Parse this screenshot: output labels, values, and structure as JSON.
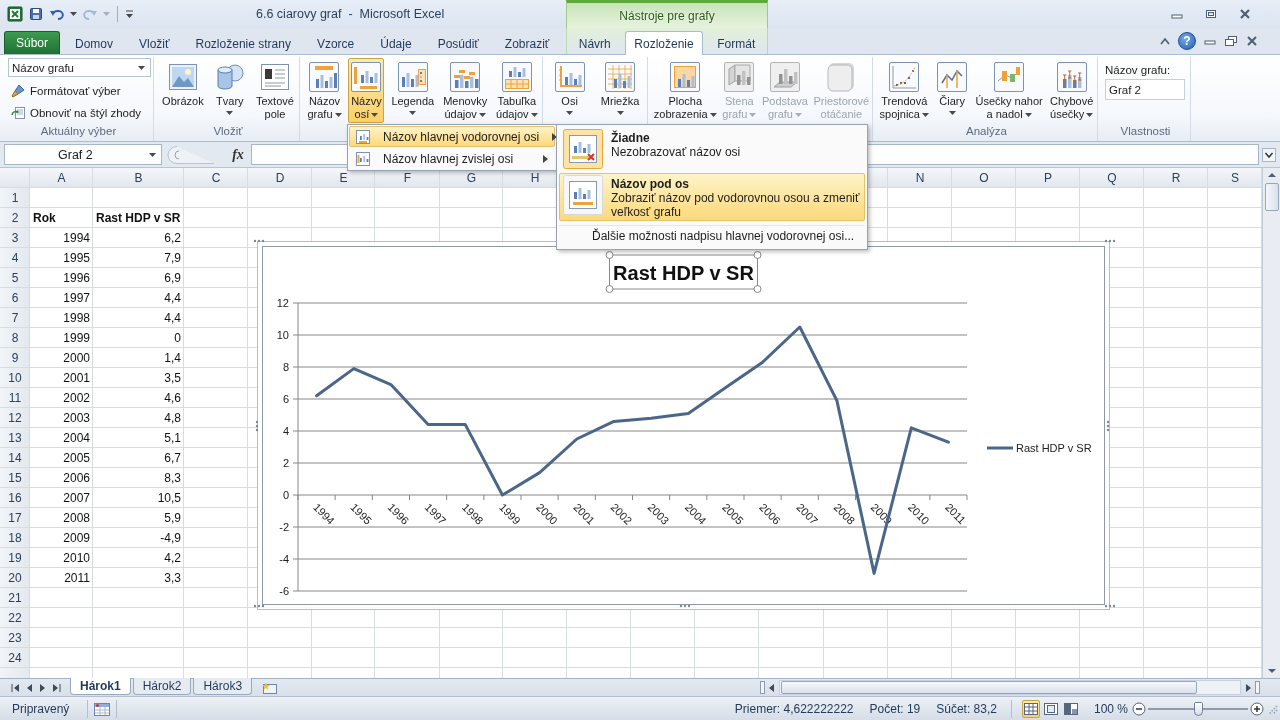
{
  "title_bar": {
    "quick_access": [
      {
        "disabled": false
      },
      {
        "disabled": false
      },
      {
        "disabled": true
      }
    ],
    "title": "6.6 ciarovy graf  -  Microsoft Excel",
    "contextual_group": "Nástroje pre grafy"
  },
  "tabs": [
    {
      "label": "Súbor",
      "kind": "file",
      "selected": false
    },
    {
      "label": "Domov",
      "kind": "normal",
      "selected": false
    },
    {
      "label": "Vložiť",
      "kind": "normal",
      "selected": false
    },
    {
      "label": "Rozloženie strany",
      "kind": "normal",
      "selected": false
    },
    {
      "label": "Vzorce",
      "kind": "normal",
      "selected": false
    },
    {
      "label": "Údaje",
      "kind": "normal",
      "selected": false
    },
    {
      "label": "Posúdiť",
      "kind": "normal",
      "selected": false
    },
    {
      "label": "Zobraziť",
      "kind": "normal",
      "selected": false
    },
    {
      "label": "Návrh",
      "kind": "contextual",
      "selected": false
    },
    {
      "label": "Rozloženie",
      "kind": "contextual",
      "selected": true
    },
    {
      "label": "Formát",
      "kind": "contextual",
      "selected": false
    }
  ],
  "help_button": "?",
  "ribbon": {
    "groups": [
      {
        "kind": "selection",
        "label": "Aktuálny výber",
        "dropdown": "Názov grafu",
        "buttons": [
          {
            "label": "Formátovať výber"
          },
          {
            "label": "Obnoviť na štýl zhody"
          }
        ]
      },
      {
        "kind": "large",
        "label": "Vložiť",
        "buttons": [
          {
            "lines": [
              "Obrázok"
            ],
            "menu": false,
            "pressed": false,
            "disabled": false
          },
          {
            "lines": [
              "Tvary"
            ],
            "menu": true,
            "pressed": false,
            "disabled": false
          },
          {
            "lines": [
              "Textové",
              "pole"
            ],
            "menu": false,
            "pressed": false,
            "disabled": false
          }
        ]
      },
      {
        "kind": "large",
        "buttons": [
          {
            "lines": [
              "Názov",
              "grafu"
            ],
            "menu": true,
            "pressed": false,
            "disabled": false
          },
          {
            "lines": [
              "Názvy",
              "osí"
            ],
            "menu": true,
            "pressed": true,
            "disabled": false
          },
          {
            "lines": [
              "Legenda"
            ],
            "menu": true,
            "pressed": false,
            "disabled": false
          },
          {
            "lines": [
              "Menovky",
              "údajov"
            ],
            "menu": true,
            "pressed": false,
            "disabled": false
          },
          {
            "lines": [
              "Tabuľka",
              "údajov"
            ],
            "menu": true,
            "pressed": false,
            "disabled": false
          }
        ]
      },
      {
        "kind": "large",
        "buttons": [
          {
            "lines": [
              "Osi"
            ],
            "menu": true,
            "pressed": false,
            "disabled": false
          },
          {
            "lines": [
              "Mriežka"
            ],
            "menu": true,
            "pressed": false,
            "disabled": false
          }
        ]
      },
      {
        "kind": "large",
        "buttons": [
          {
            "lines": [
              "Plocha",
              "zobrazenia"
            ],
            "menu": true,
            "pressed": false,
            "disabled": false
          },
          {
            "lines": [
              "Stena",
              "grafu"
            ],
            "menu": true,
            "pressed": false,
            "disabled": true
          },
          {
            "lines": [
              "Podstava",
              "grafu"
            ],
            "menu": true,
            "pressed": false,
            "disabled": true
          },
          {
            "lines": [
              "Priestorové",
              "otáčanie"
            ],
            "menu": false,
            "pressed": false,
            "disabled": true
          }
        ]
      },
      {
        "kind": "large",
        "label": "Analýza",
        "buttons": [
          {
            "lines": [
              "Trendová",
              "spojnica"
            ],
            "menu": true,
            "pressed": false,
            "disabled": false
          },
          {
            "lines": [
              "Čiary"
            ],
            "menu": true,
            "pressed": false,
            "disabled": false
          },
          {
            "lines": [
              "Úsečky nahor",
              "a nadol"
            ],
            "menu": true,
            "pressed": false,
            "disabled": false
          },
          {
            "lines": [
              "Chybové",
              "úsečky"
            ],
            "menu": true,
            "pressed": false,
            "disabled": false
          }
        ]
      },
      {
        "kind": "properties",
        "label": "Vlastnosti",
        "field_label": "Názov grafu:",
        "value": "Graf 2"
      }
    ]
  },
  "axis_titles_menu": {
    "items": [
      {
        "label": "Názov hlavnej vodorovnej osi",
        "highlighted": true
      },
      {
        "label": "Názov hlavnej zvislej osi",
        "highlighted": false
      }
    ]
  },
  "axis_title_submenu": {
    "items": [
      {
        "kind": "option",
        "title": "Žiadne",
        "description": "Nezobrazovať názov osi",
        "checked": true,
        "highlighted": false
      },
      {
        "kind": "option",
        "title": "Názov pod os",
        "description": "Zobraziť názov pod vodorovnou osou a zmeniť veľkosť grafu",
        "checked": false,
        "highlighted": true
      },
      {
        "kind": "command",
        "label": "Ďalšie možnosti nadpisu hlavnej vodorovnej osi...",
        "highlighted": false
      }
    ]
  },
  "formula_bar": {
    "name_box": "Graf 2",
    "function_button": "fx"
  },
  "sheet": {
    "columns": [
      "A",
      "B",
      "C",
      "D",
      "E",
      "F",
      "G",
      "H",
      null,
      null,
      null,
      null,
      null,
      "N",
      "O",
      "P",
      "Q",
      "R",
      "S"
    ],
    "rows": [
      {
        "number": "1"
      },
      {
        "number": "2",
        "cells": [
          {
            "text": "Rok",
            "kind": "text",
            "bold": true
          },
          {
            "text": "Rast HDP v SR",
            "kind": "text",
            "bold": true
          }
        ]
      },
      {
        "number": "3",
        "cells": [
          {
            "text": "1994",
            "kind": "number",
            "bold": false
          },
          {
            "text": "6,2",
            "kind": "number",
            "bold": false
          }
        ]
      },
      {
        "number": "4",
        "cells": [
          {
            "text": "1995",
            "kind": "number",
            "bold": false
          },
          {
            "text": "7,9",
            "kind": "number",
            "bold": false
          }
        ]
      },
      {
        "number": "5",
        "cells": [
          {
            "text": "1996",
            "kind": "number",
            "bold": false
          },
          {
            "text": "6,9",
            "kind": "number",
            "bold": false
          }
        ]
      },
      {
        "number": "6",
        "cells": [
          {
            "text": "1997",
            "kind": "number",
            "bold": false
          },
          {
            "text": "4,4",
            "kind": "number",
            "bold": false
          }
        ]
      },
      {
        "number": "7",
        "cells": [
          {
            "text": "1998",
            "kind": "number",
            "bold": false
          },
          {
            "text": "4,4",
            "kind": "number",
            "bold": false
          }
        ]
      },
      {
        "number": "8",
        "cells": [
          {
            "text": "1999",
            "kind": "number",
            "bold": false
          },
          {
            "text": "0",
            "kind": "number",
            "bold": false
          }
        ]
      },
      {
        "number": "9",
        "cells": [
          {
            "text": "2000",
            "kind": "number",
            "bold": false
          },
          {
            "text": "1,4",
            "kind": "number",
            "bold": false
          }
        ]
      },
      {
        "number": "10",
        "cells": [
          {
            "text": "2001",
            "kind": "number",
            "bold": false
          },
          {
            "text": "3,5",
            "kind": "number",
            "bold": false
          }
        ]
      },
      {
        "number": "11",
        "cells": [
          {
            "text": "2002",
            "kind": "number",
            "bold": false
          },
          {
            "text": "4,6",
            "kind": "number",
            "bold": false
          }
        ]
      },
      {
        "number": "12",
        "cells": [
          {
            "text": "2003",
            "kind": "number",
            "bold": false
          },
          {
            "text": "4,8",
            "kind": "number",
            "bold": false
          }
        ]
      },
      {
        "number": "13",
        "cells": [
          {
            "text": "2004",
            "kind": "number",
            "bold": false
          },
          {
            "text": "5,1",
            "kind": "number",
            "bold": false
          }
        ]
      },
      {
        "number": "14",
        "cells": [
          {
            "text": "2005",
            "kind": "number",
            "bold": false
          },
          {
            "text": "6,7",
            "kind": "number",
            "bold": false
          }
        ]
      },
      {
        "number": "15",
        "cells": [
          {
            "text": "2006",
            "kind": "number",
            "bold": false
          },
          {
            "text": "8,3",
            "kind": "number",
            "bold": false
          }
        ]
      },
      {
        "number": "16",
        "cells": [
          {
            "text": "2007",
            "kind": "number",
            "bold": false
          },
          {
            "text": "10,5",
            "kind": "number",
            "bold": false
          }
        ]
      },
      {
        "number": "17",
        "cells": [
          {
            "text": "2008",
            "kind": "number",
            "bold": false
          },
          {
            "text": "5,9",
            "kind": "number",
            "bold": false
          }
        ]
      },
      {
        "number": "18",
        "cells": [
          {
            "text": "2009",
            "kind": "number",
            "bold": false
          },
          {
            "text": "-4,9",
            "kind": "number",
            "bold": false
          }
        ]
      },
      {
        "number": "19",
        "cells": [
          {
            "text": "2010",
            "kind": "number",
            "bold": false
          },
          {
            "text": "4,2",
            "kind": "number",
            "bold": false
          }
        ]
      },
      {
        "number": "20",
        "cells": [
          {
            "text": "2011",
            "kind": "number",
            "bold": false
          },
          {
            "text": "3,3",
            "kind": "number",
            "bold": false
          }
        ]
      },
      {
        "number": "21"
      },
      {
        "number": "22"
      },
      {
        "number": "23"
      },
      {
        "number": "24"
      }
    ]
  },
  "chart": {
    "selected": true,
    "title_selected": true,
    "chart_data": [
      {
        "type": "line",
        "title": "Rast HDP v SR",
        "categories": [
          "1994",
          "1995",
          "1996",
          "1997",
          "1998",
          "1999",
          "2000",
          "2001",
          "2002",
          "2003",
          "2004",
          "2005",
          "2006",
          "2007",
          "2008",
          "2009",
          "2010",
          "2011"
        ],
        "series": [
          {
            "name": "Rast HDP v SR",
            "color": "#4a6688",
            "values": [
              6.2,
              7.9,
              6.9,
              4.4,
              4.4,
              0,
              1.4,
              3.5,
              4.6,
              4.8,
              5.1,
              6.7,
              8.3,
              10.5,
              5.9,
              -4.9,
              4.2,
              3.3
            ]
          }
        ],
        "ylim": [
          -6,
          12
        ],
        "yticks": [
          -6,
          -4,
          -2,
          0,
          2,
          4,
          6,
          8,
          10,
          12
        ],
        "grid": true,
        "legend": "right"
      }
    ]
  },
  "sheet_tabs": [
    {
      "label": "Hárok1",
      "selected": true
    },
    {
      "label": "Hárok2",
      "selected": false
    },
    {
      "label": "Hárok3",
      "selected": false
    }
  ],
  "status_bar": {
    "mode": "Pripravený",
    "average": "Priemer: 4,622222222",
    "count": "Počet: 19",
    "sum": "Súčet: 83,2",
    "views": [
      {
        "selected": true
      },
      {
        "selected": false
      },
      {
        "selected": false
      }
    ],
    "zoom": "100 %",
    "zoom_slider": {
      "level": 0.5
    }
  }
}
